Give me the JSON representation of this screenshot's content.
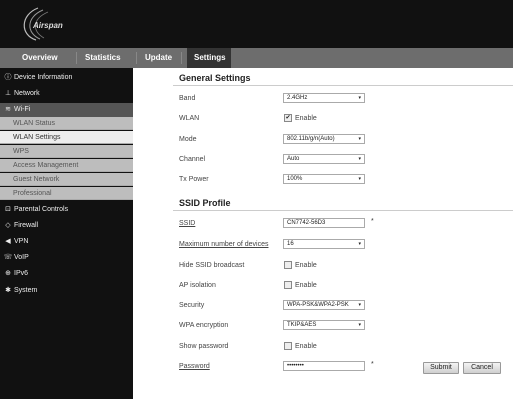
{
  "brand": {
    "logo_text": "Airspan"
  },
  "nav": {
    "overview": "Overview",
    "statistics": "Statistics",
    "update": "Update",
    "settings": "Settings"
  },
  "sidebar": {
    "device_information": "Device Information",
    "network": "Network",
    "wifi": "Wi-Fi",
    "wifi_sub": [
      "WLAN Status",
      "WLAN Settings",
      "WPS",
      "Access Management",
      "Guest Network",
      "Professional"
    ],
    "parental_controls": "Parental Controls",
    "firewall": "Firewall",
    "vpn": "VPN",
    "voip": "VoIP",
    "ipv6": "IPv6",
    "system": "System"
  },
  "general": {
    "title": "General Settings",
    "band_label": "Band",
    "band_value": "2.4GHz",
    "wlan_label": "WLAN",
    "wlan_enable": "Enable",
    "wlan_checked": "✔",
    "mode_label": "Mode",
    "mode_value": "802.11b/g/n(Auto)",
    "channel_label": "Channel",
    "channel_value": "Auto",
    "txpower_label": "Tx Power",
    "txpower_value": "100%"
  },
  "ssid": {
    "title": "SSID Profile",
    "ssid_label": "SSID",
    "ssid_value": "CN7742-56D3",
    "required": "*",
    "maxdev_label": "Maximum number of devices",
    "maxdev_value": "16",
    "hide_label": "Hide SSID broadcast",
    "hide_enable": "Enable",
    "ap_label": "AP isolation",
    "ap_enable": "Enable",
    "security_label": "Security",
    "security_value": "WPA-PSK&WPA2-PSK",
    "wpa_label": "WPA encryption",
    "wpa_value": "TKIP&AES",
    "showpw_label": "Show password",
    "showpw_enable": "Enable",
    "password_label": "Password",
    "password_value": "••••••••"
  },
  "buttons": {
    "submit": "Submit",
    "cancel": "Cancel"
  },
  "icons": {
    "dropdown": "▾",
    "info": "ⓘ",
    "network": "⊥",
    "wifi": "≋",
    "lock": "⊡",
    "shield": "◇",
    "vpn": "◀",
    "voip": "☏",
    "ipv6": "⊕",
    "gear": "✱"
  }
}
